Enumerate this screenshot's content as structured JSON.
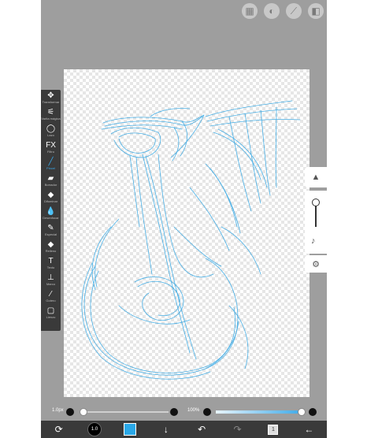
{
  "top_tools": [
    "selection-icon",
    "filter-icon",
    "ruler-icon",
    "stabilizer-icon"
  ],
  "toolbar": {
    "tools": [
      {
        "label": "Transformar",
        "icon": "✥",
        "active": false,
        "name": "transform-icon"
      },
      {
        "label": "Varita mágica",
        "icon": "⚟",
        "active": false,
        "name": "magic-wand-icon"
      },
      {
        "label": "Lazo",
        "icon": "◯",
        "active": false,
        "name": "lasso-icon"
      },
      {
        "label": "Filtro",
        "icon": "FX",
        "active": false,
        "name": "filter-icon"
      },
      {
        "label": "Pincel",
        "icon": "╱",
        "active": true,
        "name": "brush-icon"
      },
      {
        "label": "Borrador",
        "icon": "▰",
        "active": false,
        "name": "eraser-icon"
      },
      {
        "label": "Difuminar",
        "icon": "◆",
        "active": false,
        "name": "smudge-icon"
      },
      {
        "label": "Desenfocar",
        "icon": "💧",
        "active": false,
        "name": "blur-icon"
      },
      {
        "label": "Especial",
        "icon": "✎",
        "active": false,
        "name": "special-icon"
      },
      {
        "label": "Relleno",
        "icon": "◆",
        "active": false,
        "name": "fill-icon"
      },
      {
        "label": "Texto",
        "icon": "T",
        "active": false,
        "name": "text-icon"
      },
      {
        "label": "Marco",
        "icon": "⊥",
        "active": false,
        "name": "frame-icon"
      },
      {
        "label": "Gotero",
        "icon": "⁄",
        "active": false,
        "name": "eyedropper-icon"
      },
      {
        "label": "Lienzo",
        "icon": "▢",
        "active": false,
        "name": "canvas-icon"
      }
    ]
  },
  "bottom_controls": {
    "size_label": "1.0px",
    "opacity_label": "100%",
    "opacity_value": 1.0,
    "size_value": 0.0
  },
  "bottom_bar": {
    "brush_size_text": "1.0",
    "color_hex": "#2aa8e8"
  },
  "colors": {
    "stroke": "#29a3e3",
    "toolbar_bg": "#3a3a3a",
    "device_bg": "#9e9e9e"
  }
}
